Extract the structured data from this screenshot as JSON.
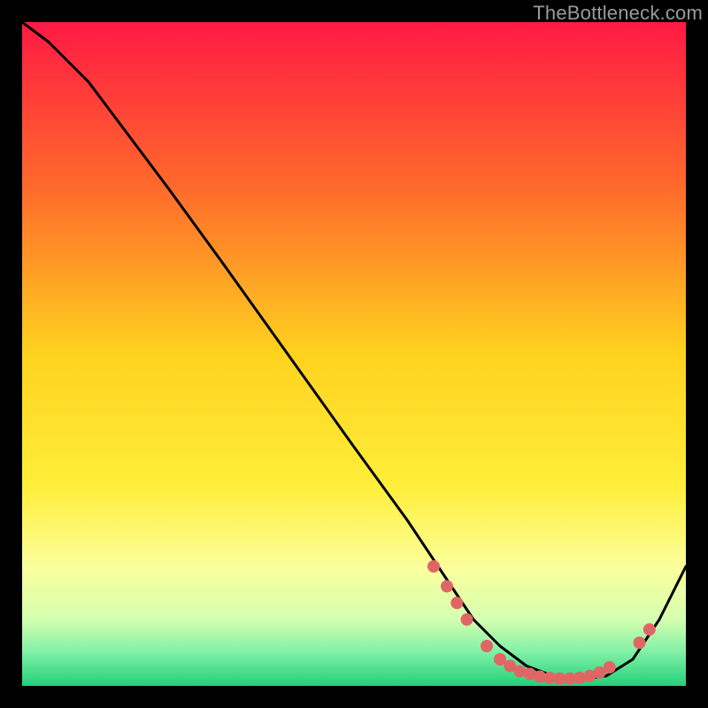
{
  "watermark": "TheBottleneck.com",
  "chart_data": {
    "type": "line",
    "title": "",
    "xlabel": "",
    "ylabel": "",
    "xlim": [
      0,
      100
    ],
    "ylim": [
      0,
      100
    ],
    "background_gradient": {
      "stops": [
        {
          "offset": 0.0,
          "color": "#ff1a44"
        },
        {
          "offset": 0.25,
          "color": "#ff6a2b"
        },
        {
          "offset": 0.5,
          "color": "#ffd21f"
        },
        {
          "offset": 0.7,
          "color": "#ffee3a"
        },
        {
          "offset": 0.82,
          "color": "#fbff9c"
        },
        {
          "offset": 0.9,
          "color": "#d4ffb0"
        },
        {
          "offset": 0.95,
          "color": "#7ff0a5"
        },
        {
          "offset": 1.0,
          "color": "#22d07a"
        }
      ]
    },
    "series": [
      {
        "name": "curve",
        "color": "#000000",
        "x": [
          0,
          4,
          10,
          16,
          22,
          30,
          40,
          50,
          58,
          64,
          68,
          72,
          76,
          80,
          84,
          88,
          92,
          96,
          100
        ],
        "y": [
          100,
          97,
          91,
          83,
          75,
          64,
          50,
          36,
          25,
          16,
          10,
          6,
          3,
          1.5,
          1,
          1.5,
          4,
          10,
          18
        ]
      }
    ],
    "markers": {
      "color": "#e06666",
      "radius": 7,
      "points": [
        {
          "x": 62,
          "y": 18
        },
        {
          "x": 64,
          "y": 15
        },
        {
          "x": 65.5,
          "y": 12.5
        },
        {
          "x": 67,
          "y": 10
        },
        {
          "x": 70,
          "y": 6
        },
        {
          "x": 72,
          "y": 4
        },
        {
          "x": 73.5,
          "y": 3
        },
        {
          "x": 75,
          "y": 2.2
        },
        {
          "x": 76.5,
          "y": 1.8
        },
        {
          "x": 78,
          "y": 1.4
        },
        {
          "x": 79.5,
          "y": 1.2
        },
        {
          "x": 81,
          "y": 1.1
        },
        {
          "x": 82.5,
          "y": 1.1
        },
        {
          "x": 84,
          "y": 1.2
        },
        {
          "x": 85.5,
          "y": 1.5
        },
        {
          "x": 87,
          "y": 2
        },
        {
          "x": 88.5,
          "y": 2.8
        },
        {
          "x": 93,
          "y": 6.5
        },
        {
          "x": 94.5,
          "y": 8.5
        }
      ]
    }
  }
}
